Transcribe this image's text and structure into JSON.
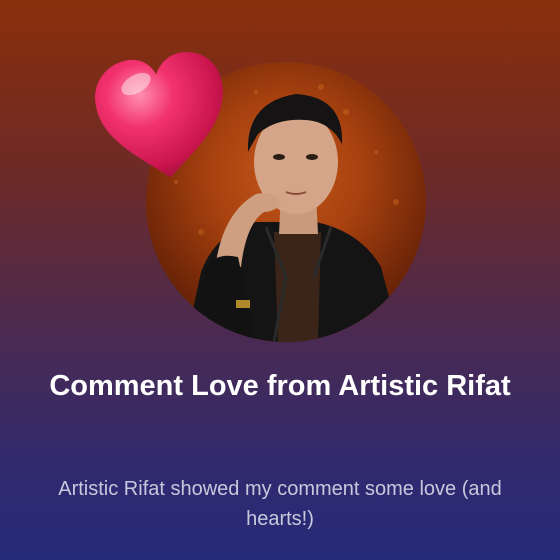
{
  "notification": {
    "title": "Comment Love from Artistic Rifat",
    "message": "Artistic Rifat  showed my comment some love (and hearts!)",
    "icons": {
      "avatar": "profile-photo",
      "reaction": "heart-icon"
    },
    "colors": {
      "background_top": "#8a2f0b",
      "background_bottom": "#262a78",
      "heart": "#e8245e",
      "title_text": "#ffffff",
      "message_text": "#c7c8dc"
    }
  }
}
